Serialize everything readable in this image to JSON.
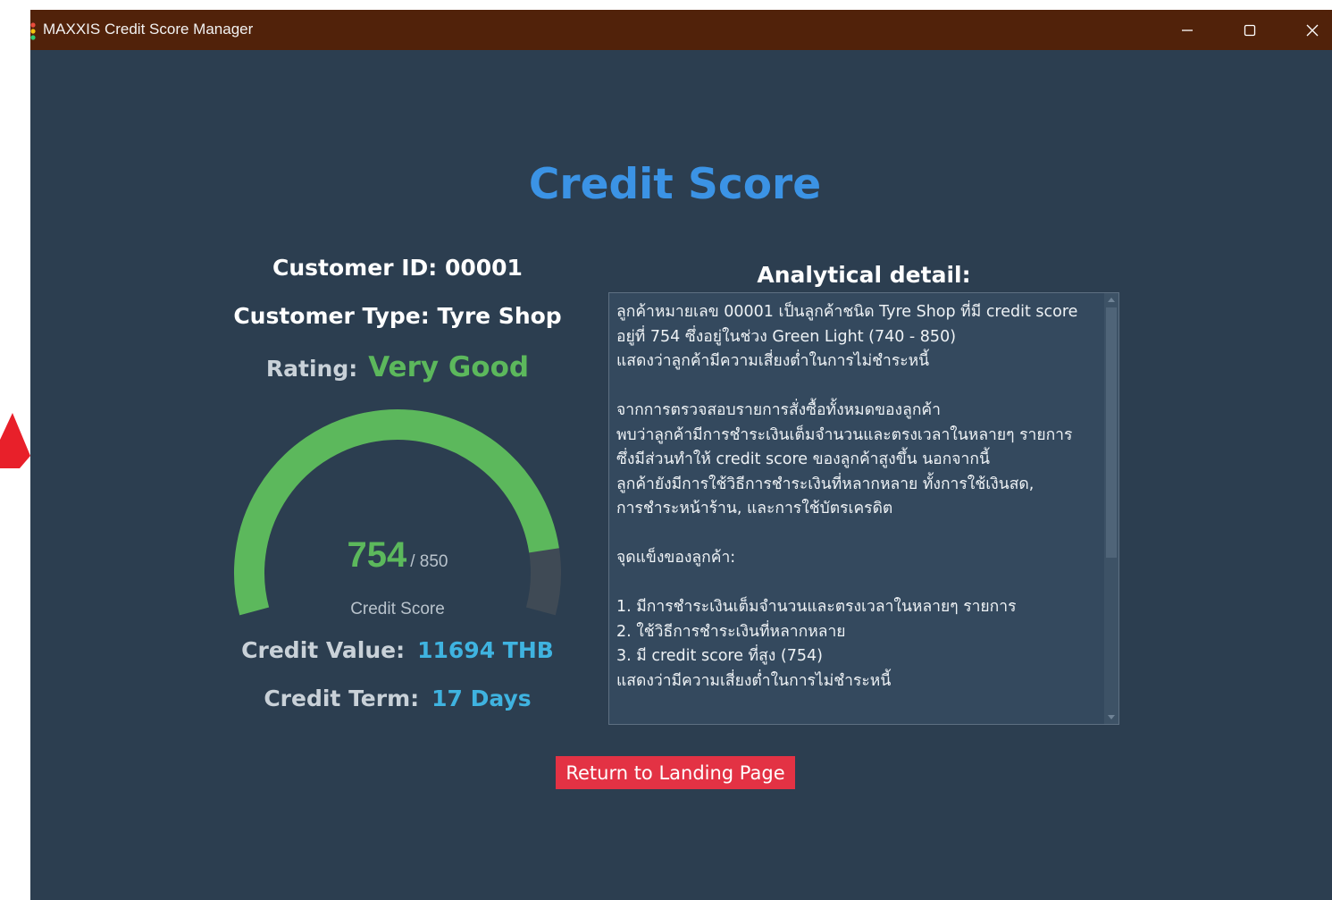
{
  "window": {
    "title": "MAXXIS Credit Score Manager"
  },
  "heading": "Credit Score",
  "customer": {
    "id_line": "Customer ID: 00001",
    "type_line": "Customer Type: Tyre Shop",
    "rating_label": "Rating:",
    "rating_value": "Very Good"
  },
  "gauge": {
    "score": "754",
    "max": "/ 850",
    "label": "Credit Score",
    "fraction": 0.887,
    "fill_color": "#5cb85c",
    "track_color": "#3f4a55"
  },
  "credit": {
    "value_label": "Credit Value:",
    "value": "11694 THB",
    "term_label": "Credit Term:",
    "term": "17 Days"
  },
  "analysis": {
    "title": "Analytical detail:",
    "text": "ลูกค้าหมายเลข 00001 เป็นลูกค้าชนิด Tyre Shop ที่มี credit score\nอยู่ที่ 754 ซึ่งอยู่ในช่วง Green Light (740 - 850)\nแสดงว่าลูกค้ามีความเสี่ยงต่ำในการไม่ชำระหนี้\n\nจากการตรวจสอบรายการสั่งซื้อทั้งหมดของลูกค้า\nพบว่าลูกค้ามีการชำระเงินเต็มจำนวนและตรงเวลาในหลายๆ รายการ\nซึ่งมีส่วนทำให้ credit score ของลูกค้าสูงขึ้น นอกจากนี้\nลูกค้ายังมีการใช้วิธีการชำระเงินที่หลากหลาย ทั้งการใช้เงินสด,\nการชำระหน้าร้าน, และการใช้บัตรเครดิต\n\nจุดแข็งของลูกค้า:\n\n1. มีการชำระเงินเต็มจำนวนและตรงเวลาในหลายๆ รายการ\n2. ใช้วิธีการชำระเงินที่หลากหลาย\n3. มี credit score ที่สูง (754)\nแสดงว่ามีความเสี่ยงต่ำในการไม่ชำระหนี้"
  },
  "return_button": "Return to Landing Page",
  "colors": {
    "background": "#2c3e50",
    "titlebar": "#51220a",
    "heading": "#3b93e5",
    "accent_green": "#5cb85c",
    "accent_blue": "#3fb3e0",
    "button": "#e33244"
  }
}
